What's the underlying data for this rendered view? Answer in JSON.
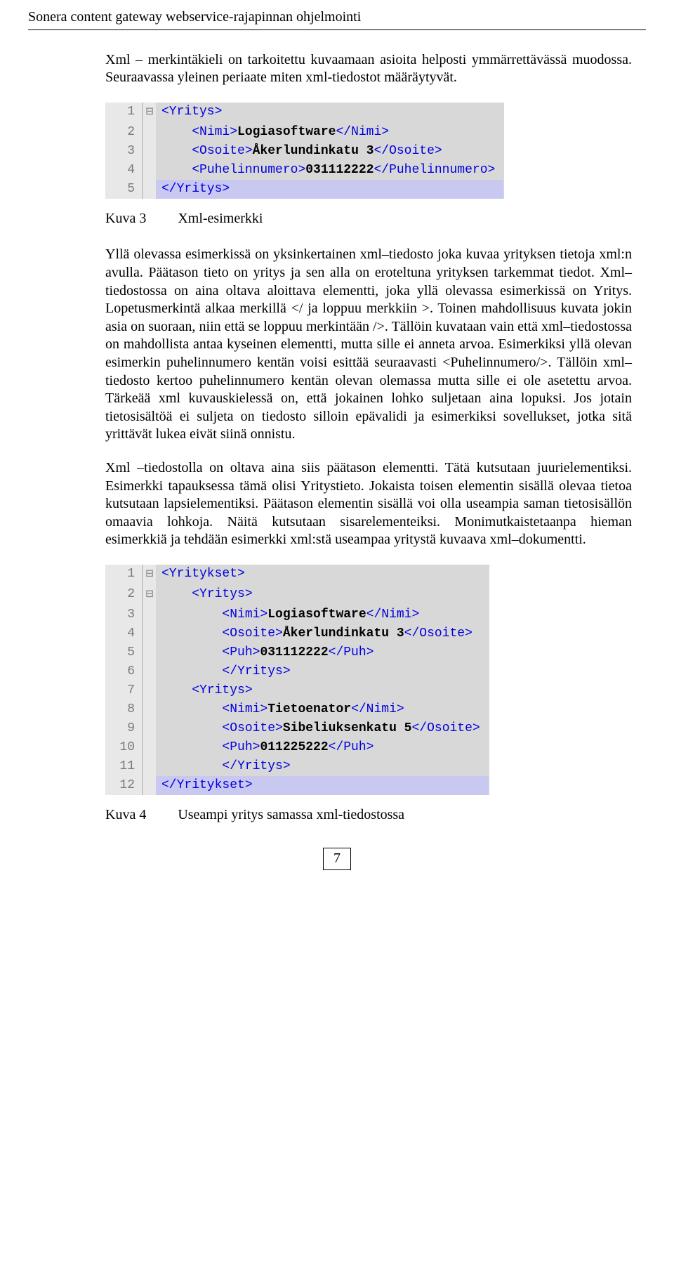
{
  "header": {
    "title": "Sonera content gateway webservice-rajapinnan ohjelmointi"
  },
  "intro": "Xml – merkintäkieli on tarkoitettu kuvaamaan asioita helposti ymmärrettävässä muodossa. Seuraavassa yleinen periaate miten xml-tiedostot määräytyvät.",
  "code1": {
    "lines": [
      "1",
      "2",
      "3",
      "4",
      "5"
    ],
    "l1_open": "<Yritys>",
    "l2_open": "<Nimi>",
    "l2_txt": "Logiasoftware",
    "l2_close": "</Nimi>",
    "l3_open": "<Osoite>",
    "l3_txt": "Åkerlundinkatu 3",
    "l3_close": "</Osoite>",
    "l4_open": "<Puhelinnumero>",
    "l4_txt": "031112222",
    "l4_close": "</Puhelinnumero>",
    "l5_close": "</Yritys>"
  },
  "caption1": {
    "label": "Kuva 3",
    "text": "Xml-esimerkki"
  },
  "body1": "Yllä olevassa esimerkissä on yksinkertainen xml–tiedosto joka kuvaa yrityksen tietoja xml:n avulla. Päätason tieto on yritys ja sen alla on eroteltuna yrityksen tarkemmat tiedot. Xml–tiedostossa on aina oltava aloittava elementti, joka yllä olevassa esimerkissä on Yritys. Lopetusmerkintä alkaa merkillä </ ja loppuu merkkiin >. Toinen mahdollisuus kuvata jokin asia on suoraan, niin että se loppuu merkintään />. Tällöin kuvataan vain että xml–tiedostossa on mahdollista antaa kyseinen elementti, mutta sille ei anneta arvoa. Esimerkiksi yllä olevan esimerkin puhelinnumero kentän voisi esittää seuraavasti <Puhelinnumero/>. Tällöin xml–tiedosto kertoo puhelinnumero kentän olevan olemassa mutta sille ei ole asetettu arvoa. Tärkeää xml kuvauskielessä on, että jokainen lohko suljetaan aina lopuksi. Jos jotain tietosisältöä ei suljeta on tiedosto silloin epävalidi ja esimerkiksi sovellukset, jotka sitä yrittävät lukea eivät siinä onnistu.",
  "body2": "Xml –tiedostolla on oltava aina siis päätason elementti. Tätä kutsutaan juurielementiksi. Esimerkki tapauksessa tämä olisi Yritystieto. Jokaista toisen elementin sisällä olevaa tietoa kutsutaan lapsielementiksi. Päätason elementin sisällä voi olla useampia saman tietosisällön omaavia lohkoja. Näitä kutsutaan sisarelementeiksi. Monimutkaistetaanpa hieman esimerkkiä ja tehdään esimerkki xml:stä useampaa yritystä kuvaava xml–dokumentti.",
  "code2": {
    "lines": [
      "1",
      "2",
      "3",
      "4",
      "5",
      "6",
      "7",
      "8",
      "9",
      "10",
      "11",
      "12"
    ],
    "l1": "<Yritykset>",
    "l2": "<Yritys>",
    "l3o": "<Nimi>",
    "l3t": "Logiasoftware",
    "l3c": "</Nimi>",
    "l4o": "<Osoite>",
    "l4t": "Åkerlundinkatu 3",
    "l4c": "</Osoite>",
    "l5o": "<Puh>",
    "l5t": "031112222",
    "l5c": "</Puh>",
    "l6": "</Yritys>",
    "l7": "<Yritys>",
    "l8o": "<Nimi>",
    "l8t": "Tietoenator",
    "l8c": "</Nimi>",
    "l9o": "<Osoite>",
    "l9t": "Sibeliuksenkatu 5",
    "l9c": "</Osoite>",
    "l10o": "<Puh>",
    "l10t": "011225222",
    "l10c": "</Puh>",
    "l11": "</Yritys>",
    "l12": "</Yritykset>"
  },
  "caption2": {
    "label": "Kuva 4",
    "text": "Useampi yritys samassa xml-tiedostossa"
  },
  "footer": {
    "page": "7"
  }
}
